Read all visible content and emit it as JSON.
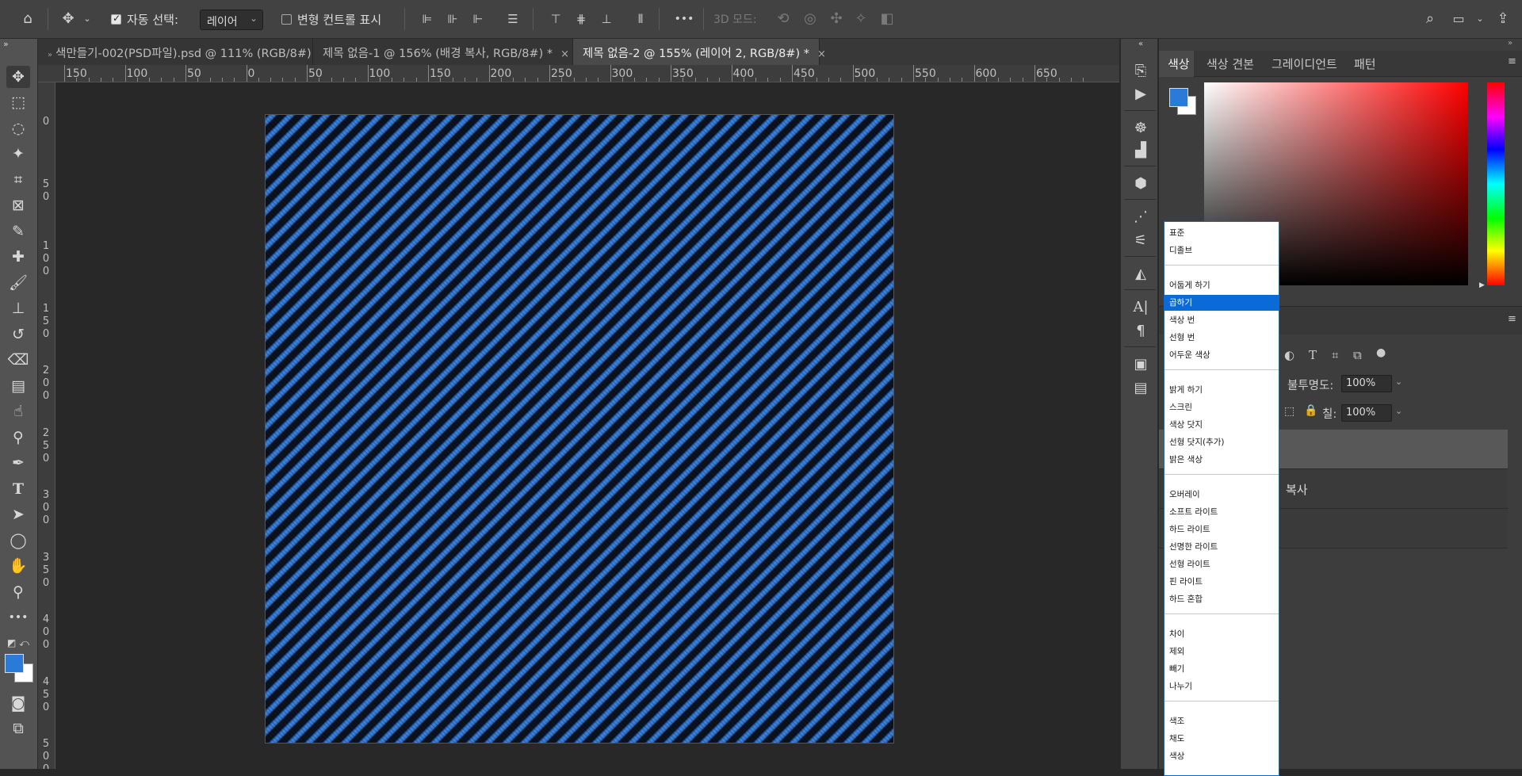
{
  "options_bar": {
    "auto_select_label": "자동 선택:",
    "auto_select_checked": true,
    "auto_select_target": "레이어",
    "transform_controls_label": "변형 컨트롤 표시",
    "mode_3d_label": "3D 모드:",
    "more_glyph": "•••"
  },
  "tabs": [
    {
      "label": "색만들기-002(PSD파일).psd @ 111% (RGB/8#)",
      "close": "×"
    },
    {
      "label": "제목 없음-1 @ 156% (배경 복사, RGB/8#) *",
      "close": "×"
    },
    {
      "label": "제목 없음-2 @ 155% (레이어 2, RGB/8#) *",
      "close": "×"
    }
  ],
  "ruler_top": [
    "150",
    "100",
    "50",
    "0",
    "50",
    "100",
    "150",
    "200",
    "250",
    "300",
    "350",
    "400",
    "450",
    "500",
    "550",
    "600",
    "650"
  ],
  "ruler_left": [
    "0",
    "5\n0",
    "1\n0\n0",
    "1\n5\n0",
    "2\n0\n0",
    "2\n5\n0",
    "3\n0\n0",
    "3\n5\n0",
    "4\n0\n0",
    "4\n5\n0",
    "5\n0\n0"
  ],
  "panel_tabs": [
    "색상",
    "색상 견본",
    "그레이디언트",
    "패턴"
  ],
  "colors": {
    "foreground": "#2a7ad8",
    "background": "#ffffff",
    "accent": "#0a6ad8"
  },
  "layers": {
    "opacity_label": "불투명도:",
    "opacity_value": "100%",
    "fill_label": "칠:",
    "fill_value": "100%",
    "row_text": "복사"
  },
  "blend_menu": {
    "groups": [
      [
        "표준",
        "디졸브"
      ],
      [
        "어둡게 하기",
        "곱하기",
        "색상 번",
        "선형 번",
        "어두운 색상"
      ],
      [
        "밝게 하기",
        "스크린",
        "색상 닷지",
        "선형 닷지(추가)",
        "밝은 색상"
      ],
      [
        "오버레이",
        "소프트 라이트",
        "하드 라이트",
        "선명한 라이트",
        "선형 라이트",
        "핀 라이트",
        "하드 혼합"
      ],
      [
        "차이",
        "제외",
        "빼기",
        "나누기"
      ],
      [
        "색조",
        "채도",
        "색상"
      ]
    ],
    "highlighted": "곱하기"
  }
}
